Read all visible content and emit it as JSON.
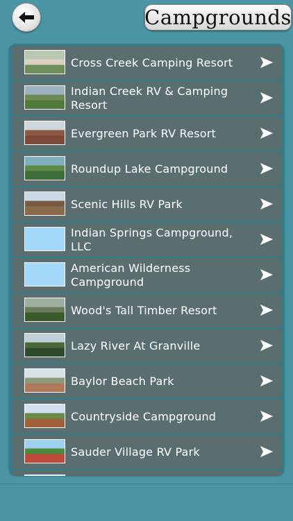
{
  "header": {
    "title": "Campgrounds"
  },
  "colors": {
    "background": "#4a96a6",
    "panel": "#2f7d8c",
    "row": "#5a6e6f",
    "text": "#ffffff",
    "placeholder_thumb": "#a4d8f8"
  },
  "list": {
    "items": [
      {
        "name": "Cross Creek Camping Resort",
        "thumb": "photo"
      },
      {
        "name": "Indian Creek RV & Camping Resort",
        "thumb": "photo"
      },
      {
        "name": "Evergreen Park RV Resort",
        "thumb": "photo"
      },
      {
        "name": "Roundup Lake Campground",
        "thumb": "photo"
      },
      {
        "name": "Scenic Hills RV Park",
        "thumb": "photo"
      },
      {
        "name": "Indian Springs Campground, LLC",
        "thumb": "placeholder"
      },
      {
        "name": "American Wilderness Campground",
        "thumb": "placeholder"
      },
      {
        "name": "Wood's Tall Timber Resort",
        "thumb": "photo"
      },
      {
        "name": "Lazy River At Granville",
        "thumb": "photo"
      },
      {
        "name": "Baylor Beach Park",
        "thumb": "photo"
      },
      {
        "name": "Countryside Campground",
        "thumb": "photo"
      },
      {
        "name": "Sauder Village RV Park",
        "thumb": "photo"
      },
      {
        "name": "",
        "thumb": "photo"
      }
    ]
  },
  "icons": {
    "back": "back-arrow-icon",
    "row_arrow": "chevron-right-icon"
  }
}
